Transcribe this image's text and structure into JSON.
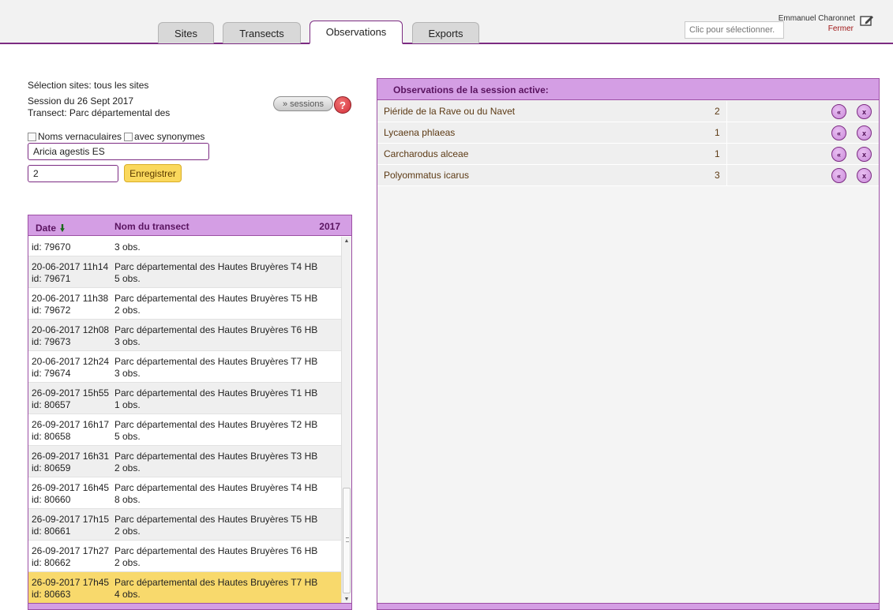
{
  "tabs": [
    {
      "label": "Sites",
      "active": false
    },
    {
      "label": "Transects",
      "active": false
    },
    {
      "label": "Observations",
      "active": true
    },
    {
      "label": "Exports",
      "active": false
    }
  ],
  "header": {
    "search_placeholder": "Clic pour sélectionner.",
    "user_name": "Emmanuel Charonnet",
    "logout_label": "Fermer",
    "edit_icon": "edit-icon"
  },
  "form": {
    "selection_label": "Sélection sites: tous les sites",
    "session_label": "Session du 26 Sept 2017",
    "transect_label": "Transect: Parc départemental des",
    "sessions_button": "» sessions",
    "help_button": "?",
    "vernacular_label": "Noms vernaculaires",
    "synonyms_label": "avec synonymes",
    "species_value": "Aricia agestis ES",
    "count_value": "2",
    "save_button": "Enregistrer"
  },
  "sessions_table": {
    "col_date": "Date",
    "sort_icon": "arrow-down-icon",
    "col_name": "Nom du transect",
    "col_year": "2017",
    "rows": [
      {
        "date": "",
        "id": "id: 79670",
        "name": "",
        "obs": "3 obs."
      },
      {
        "date": "20-06-2017 11h14",
        "id": "id: 79671",
        "name": "Parc départemental des Hautes Bruyères T4 HB",
        "obs": "5 obs."
      },
      {
        "date": "20-06-2017 11h38",
        "id": "id: 79672",
        "name": "Parc départemental des Hautes Bruyères T5 HB",
        "obs": "2 obs."
      },
      {
        "date": "20-06-2017 12h08",
        "id": "id: 79673",
        "name": "Parc départemental des Hautes Bruyères T6 HB",
        "obs": "3 obs."
      },
      {
        "date": "20-06-2017 12h24",
        "id": "id: 79674",
        "name": "Parc départemental des Hautes Bruyères T7 HB",
        "obs": "3 obs."
      },
      {
        "date": "26-09-2017 15h55",
        "id": "id: 80657",
        "name": "Parc départemental des Hautes Bruyères T1 HB",
        "obs": "1 obs."
      },
      {
        "date": "26-09-2017 16h17",
        "id": "id: 80658",
        "name": "Parc départemental des Hautes Bruyères T2 HB",
        "obs": "5 obs."
      },
      {
        "date": "26-09-2017 16h31",
        "id": "id: 80659",
        "name": "Parc départemental des Hautes Bruyères T3 HB",
        "obs": "2 obs."
      },
      {
        "date": "26-09-2017 16h45",
        "id": "id: 80660",
        "name": "Parc départemental des Hautes Bruyères T4 HB",
        "obs": "8 obs."
      },
      {
        "date": "26-09-2017 17h15",
        "id": "id: 80661",
        "name": "Parc départemental des Hautes Bruyères T5 HB",
        "obs": "2 obs."
      },
      {
        "date": "26-09-2017 17h27",
        "id": "id: 80662",
        "name": "Parc départemental des Hautes Bruyères T6 HB",
        "obs": "2 obs."
      },
      {
        "date": "26-09-2017 17h45",
        "id": "id: 80663",
        "name": "Parc départemental des Hautes Bruyères T7 HB",
        "obs": "4 obs.",
        "selected": true
      }
    ]
  },
  "observations": {
    "title": "Observations de la session active:",
    "rows": [
      {
        "species": "Piéride de la Rave ou du Navet",
        "count": "2"
      },
      {
        "species": "Lycaena phlaeas",
        "count": "1"
      },
      {
        "species": "Carcharodus alceae",
        "count": "1"
      },
      {
        "species": "Polyommatus icarus",
        "count": "3"
      }
    ],
    "prev_button": "«",
    "delete_button": "x"
  }
}
